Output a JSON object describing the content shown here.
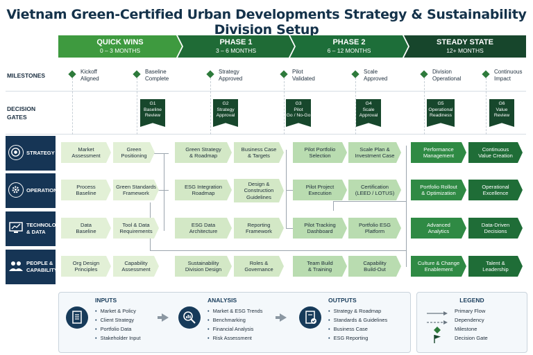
{
  "title": "Vietnam Green-Certified Urban Developments Strategy & Sustainability Division Setup",
  "phases": [
    {
      "name": "QUICK WINS",
      "duration": "0 – 3 MONTHS"
    },
    {
      "name": "PHASE 1",
      "duration": "3 – 6 MONTHS"
    },
    {
      "name": "PHASE 2",
      "duration": "6 – 12 MONTHS"
    },
    {
      "name": "STEADY STATE",
      "duration": "12+ MONTHS"
    }
  ],
  "row_labels": {
    "milestones": "MILESTONES",
    "gates_1": "DECISION",
    "gates_2": "GATES"
  },
  "milestones": [
    {
      "l1": "Kickoff",
      "l2": "Aligned"
    },
    {
      "l1": "Baseline",
      "l2": "Complete"
    },
    {
      "l1": "Strategy",
      "l2": "Approved"
    },
    {
      "l1": "Pilot",
      "l2": "Validated"
    },
    {
      "l1": "Scale",
      "l2": "Approved"
    },
    {
      "l1": "Division",
      "l2": "Operational"
    },
    {
      "l1": "Continuous",
      "l2": "Impact"
    }
  ],
  "gates": [
    {
      "id": "G1",
      "l1": "Baseline",
      "l2": "Review"
    },
    {
      "id": "G2",
      "l1": "Strategy",
      "l2": "Approval"
    },
    {
      "id": "G3",
      "l1": "Pilot",
      "l2": "Go / No-Go"
    },
    {
      "id": "G4",
      "l1": "Scale",
      "l2": "Approval"
    },
    {
      "id": "G5",
      "l1": "Operational",
      "l2": "Readiness"
    },
    {
      "id": "G6",
      "l1": "Value",
      "l2": "Review"
    }
  ],
  "streams": [
    {
      "l1": "STRATEGY",
      "l2": "",
      "icon": "target-icon"
    },
    {
      "l1": "OPERATIONS",
      "l2": "",
      "icon": "gear-icon"
    },
    {
      "l1": "TECHNOLOGY",
      "l2": "& DATA",
      "icon": "monitor-chart-icon"
    },
    {
      "l1": "PEOPLE &",
      "l2": "CAPABILITY",
      "icon": "people-icon"
    }
  ],
  "grid": [
    [
      {
        "l1": "Market",
        "l2": "Assessment"
      },
      {
        "l1": "Green",
        "l2": "Positioning"
      },
      {
        "l1": "Green Strategy",
        "l2": "& Roadmap"
      },
      {
        "l1": "Business Case",
        "l2": "& Targets"
      },
      {
        "l1": "Pilot Portfolio",
        "l2": "Selection"
      },
      {
        "l1": "Scale Plan &",
        "l2": "Investment Case"
      },
      {
        "l1": "Performance",
        "l2": "Management"
      },
      {
        "l1": "Continuous",
        "l2": "Value Creation"
      }
    ],
    [
      {
        "l1": "Process",
        "l2": "Baseline"
      },
      {
        "l1": "Green Standards",
        "l2": "Framework"
      },
      {
        "l1": "ESG Integration",
        "l2": "Roadmap"
      },
      {
        "l1": "Design &",
        "l2": "Construction",
        "l3": "Guidelines"
      },
      {
        "l1": "Pilot Project",
        "l2": "Execution"
      },
      {
        "l1": "Certification",
        "l2": "(LEED / LOTUS)"
      },
      {
        "l1": "Portfolio Rollout",
        "l2": "& Optimization"
      },
      {
        "l1": "Operational",
        "l2": "Excellence"
      }
    ],
    [
      {
        "l1": "Data",
        "l2": "Baseline"
      },
      {
        "l1": "Tool & Data",
        "l2": "Requirements"
      },
      {
        "l1": "ESG Data",
        "l2": "Architecture"
      },
      {
        "l1": "Reporting",
        "l2": "Framework"
      },
      {
        "l1": "Pilot Tracking",
        "l2": "Dashboard"
      },
      {
        "l1": "Portfolio ESG",
        "l2": "Platform"
      },
      {
        "l1": "Advanced",
        "l2": "Analytics"
      },
      {
        "l1": "Data-Driven",
        "l2": "Decisions"
      }
    ],
    [
      {
        "l1": "Org Design",
        "l2": "Principles"
      },
      {
        "l1": "Capability",
        "l2": "Assessment"
      },
      {
        "l1": "Sustainability",
        "l2": "Division Design"
      },
      {
        "l1": "Roles &",
        "l2": "Governance"
      },
      {
        "l1": "Team Build",
        "l2": "& Training"
      },
      {
        "l1": "Capability",
        "l2": "Build-Out"
      },
      {
        "l1": "Culture & Change",
        "l2": "Enablement"
      },
      {
        "l1": "Talent &",
        "l2": "Leadership"
      }
    ]
  ],
  "inputs": {
    "title": "INPUTS",
    "items": [
      "Market & Policy",
      "Client Strategy",
      "Portfolio Data",
      "Stakeholder Input"
    ],
    "icon": "document-list-icon"
  },
  "analysis": {
    "title": "ANALYSIS",
    "items": [
      "Market & ESG Trends",
      "Benchmarking",
      "Financial Analysis",
      "Risk Assessment"
    ],
    "icon": "magnifier-chart-icon"
  },
  "outputs": {
    "title": "OUTPUTS",
    "items": [
      "Strategy & Roadmap",
      "Standards & Guidelines",
      "Business Case",
      "ESG Reporting"
    ],
    "icon": "document-check-icon"
  },
  "legend": {
    "title": "LEGEND",
    "items": [
      {
        "label": "Primary Flow",
        "icon": "solid-arrow-icon"
      },
      {
        "label": "Dependency",
        "icon": "dashed-arrow-icon"
      },
      {
        "label": "Milestone",
        "icon": "diamond-icon"
      },
      {
        "label": "Decision Gate",
        "icon": "flag-icon"
      }
    ]
  },
  "colors": {
    "navy": "#163555",
    "dark_green": "#17462c",
    "green": "#3e9a3f",
    "light_green": "#e2f0d6"
  }
}
